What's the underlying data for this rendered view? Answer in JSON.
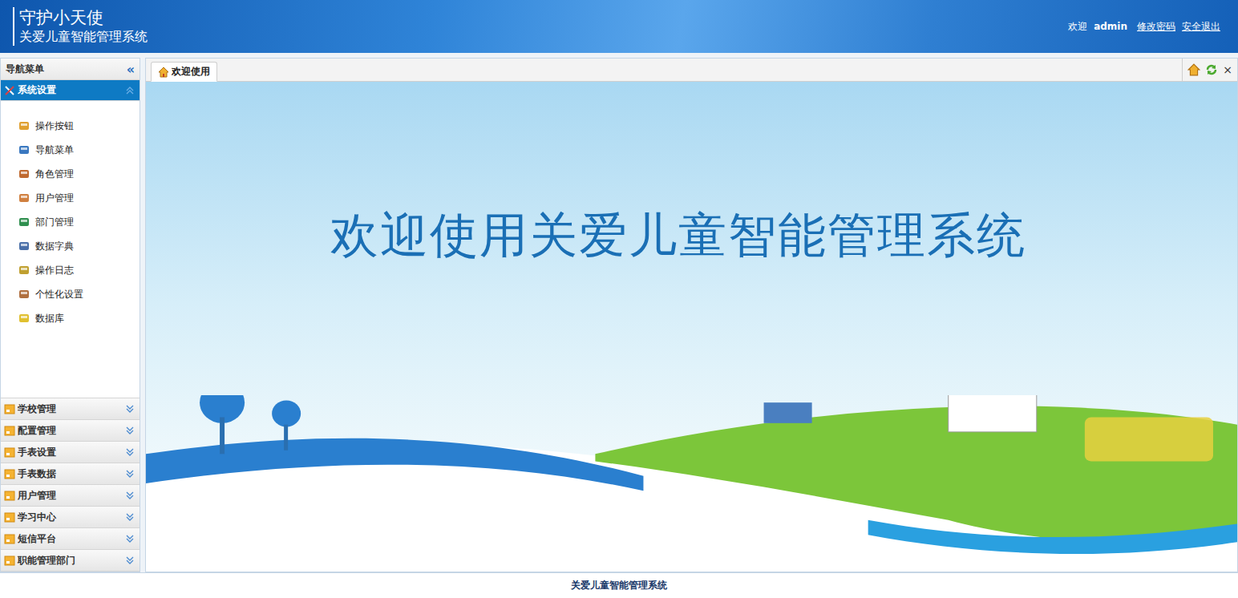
{
  "header": {
    "logo_title": "守护小天使",
    "logo_subtitle": "关爱儿童智能管理系统",
    "welcome": "欢迎",
    "user": "admin",
    "links": [
      "修改密码",
      "安全退出"
    ]
  },
  "sidebar": {
    "title": "导航菜单",
    "collapse_glyph": "«",
    "groups": [
      {
        "label": "系统设置",
        "expanded": true,
        "items": [
          "操作按钮",
          "导航菜单",
          "角色管理",
          "用户管理",
          "部门管理",
          "数据字典",
          "操作日志",
          "个性化设置",
          "数据库"
        ]
      },
      {
        "label": "学校管理",
        "expanded": false,
        "items": []
      },
      {
        "label": "配置管理",
        "expanded": false,
        "items": []
      },
      {
        "label": "手表设置",
        "expanded": false,
        "items": []
      },
      {
        "label": "手表数据",
        "expanded": false,
        "items": []
      },
      {
        "label": "用户管理",
        "expanded": false,
        "items": []
      },
      {
        "label": "学习中心",
        "expanded": false,
        "items": []
      },
      {
        "label": "短信平台",
        "expanded": false,
        "items": []
      },
      {
        "label": "职能管理部门",
        "expanded": false,
        "items": []
      }
    ]
  },
  "tabs": [
    {
      "label": "欢迎使用",
      "selected": true
    }
  ],
  "tab_close_glyph": "×",
  "banner": {
    "title": "欢迎使用关爱儿童智能管理系统"
  },
  "footer": "关爱儿童智能管理系统"
}
